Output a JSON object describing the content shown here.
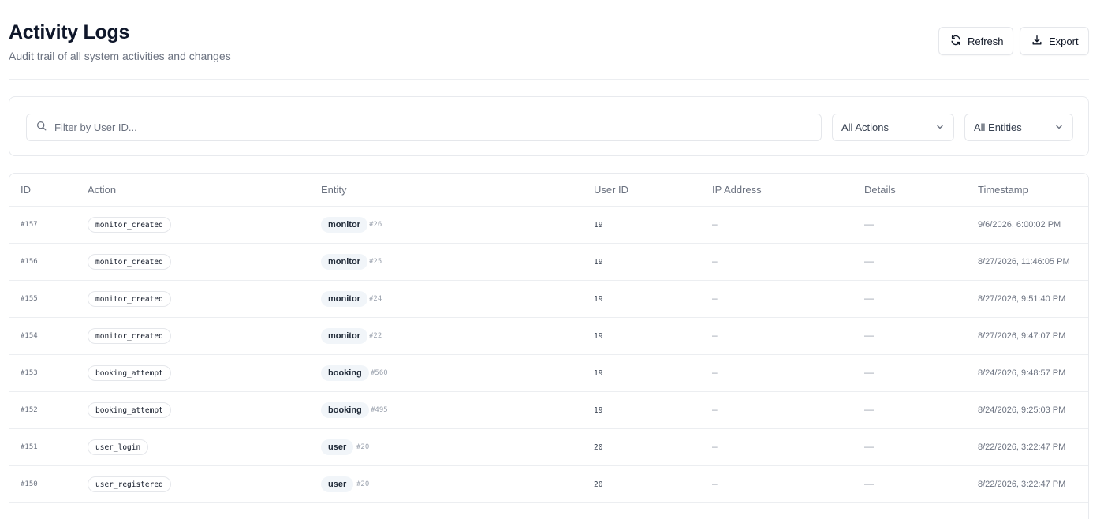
{
  "header": {
    "title": "Activity Logs",
    "subtitle": "Audit trail of all system activities and changes",
    "refresh_label": "Refresh",
    "export_label": "Export"
  },
  "filters": {
    "search_placeholder": "Filter by User ID...",
    "action_select": "All Actions",
    "entity_select": "All Entities"
  },
  "table": {
    "columns": [
      "ID",
      "Action",
      "Entity",
      "User ID",
      "IP Address",
      "Details",
      "Timestamp"
    ],
    "rows": [
      {
        "id": "#157",
        "action": "monitor_created",
        "entity": "monitor",
        "entity_id": "#26",
        "user_id": "19",
        "ip": "–",
        "details": "—",
        "timestamp": "9/6/2026, 6:00:02 PM"
      },
      {
        "id": "#156",
        "action": "monitor_created",
        "entity": "monitor",
        "entity_id": "#25",
        "user_id": "19",
        "ip": "–",
        "details": "—",
        "timestamp": "8/27/2026, 11:46:05 PM"
      },
      {
        "id": "#155",
        "action": "monitor_created",
        "entity": "monitor",
        "entity_id": "#24",
        "user_id": "19",
        "ip": "–",
        "details": "—",
        "timestamp": "8/27/2026, 9:51:40 PM"
      },
      {
        "id": "#154",
        "action": "monitor_created",
        "entity": "monitor",
        "entity_id": "#22",
        "user_id": "19",
        "ip": "–",
        "details": "—",
        "timestamp": "8/27/2026, 9:47:07 PM"
      },
      {
        "id": "#153",
        "action": "booking_attempt",
        "entity": "booking",
        "entity_id": "#560",
        "user_id": "19",
        "ip": "–",
        "details": "—",
        "timestamp": "8/24/2026, 9:48:57 PM"
      },
      {
        "id": "#152",
        "action": "booking_attempt",
        "entity": "booking",
        "entity_id": "#495",
        "user_id": "19",
        "ip": "–",
        "details": "—",
        "timestamp": "8/24/2026, 9:25:03 PM"
      },
      {
        "id": "#151",
        "action": "user_login",
        "entity": "user",
        "entity_id": "#20",
        "user_id": "20",
        "ip": "–",
        "details": "—",
        "timestamp": "8/22/2026, 3:22:47 PM"
      },
      {
        "id": "#150",
        "action": "user_registered",
        "entity": "user",
        "entity_id": "#20",
        "user_id": "20",
        "ip": "–",
        "details": "—",
        "timestamp": "8/22/2026, 3:22:47 PM"
      }
    ]
  }
}
